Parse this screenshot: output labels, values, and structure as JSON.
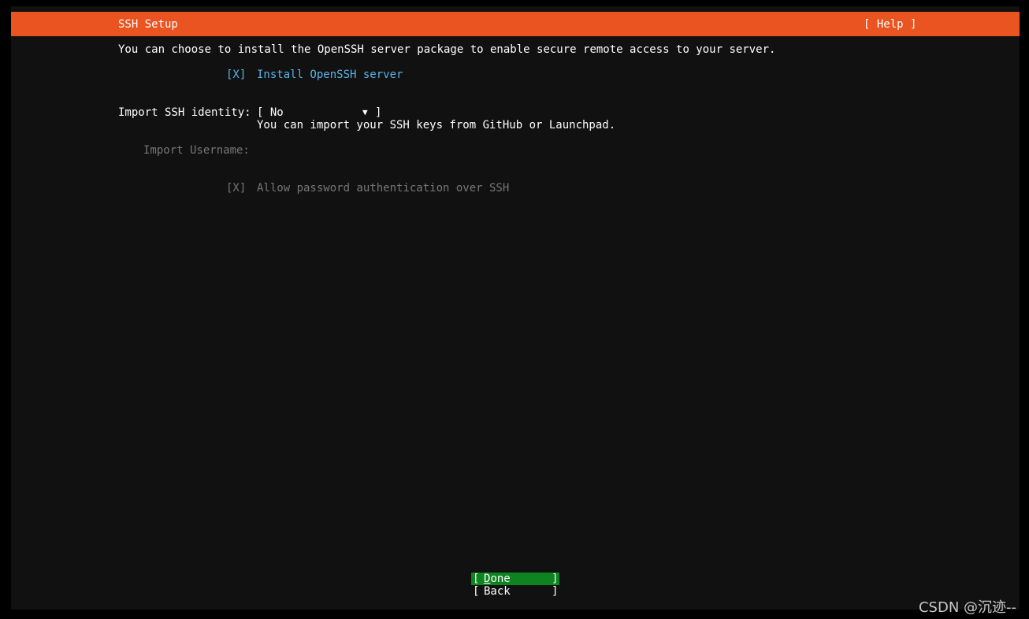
{
  "header": {
    "title": "SSH Setup",
    "help": "[ Help ]"
  },
  "intro": "You can choose to install the OpenSSH server package to enable secure remote access to your server.",
  "install_openssh": {
    "checkbox": "[X]",
    "label": "Install OpenSSH server"
  },
  "import_identity": {
    "label": "Import SSH identity:",
    "select_open": "[ No",
    "arrow": "▼",
    "select_close": "]",
    "hint": "You can import your SSH keys from GitHub or Launchpad."
  },
  "import_username": {
    "label": "Import Username:"
  },
  "allow_password": {
    "checkbox": "[X]",
    "label": "Allow password authentication over SSH"
  },
  "buttons": {
    "done_open": "[ ",
    "done_label_first": "D",
    "done_label_rest": "one",
    "done_close": "]",
    "back_open": "[ ",
    "back_label": "Back",
    "back_close": "]"
  },
  "watermark": "CSDN @沉迹--",
  "colors": {
    "title_bar": "#e95420",
    "background": "#111111",
    "selected_text": "#5ab4e8",
    "done_button": "#0e8420",
    "disabled_text": "#777777"
  }
}
